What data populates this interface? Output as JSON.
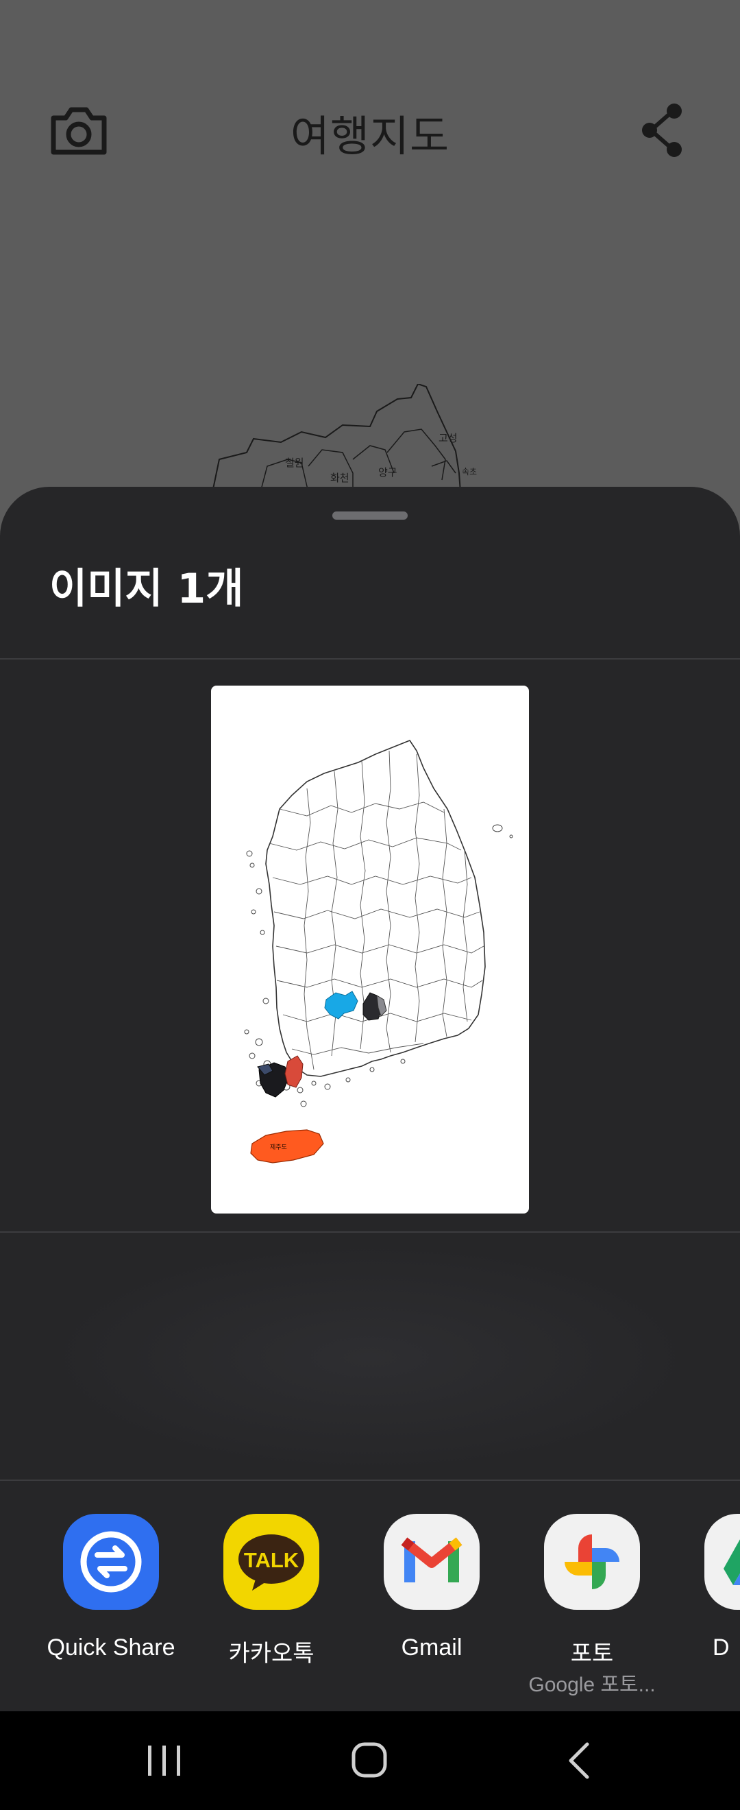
{
  "app": {
    "title": "여행지도",
    "camera_icon": "camera-icon",
    "share_icon": "share-icon",
    "map_labels": [
      "철원",
      "화천",
      "양구",
      "고성",
      "속초"
    ]
  },
  "sheet": {
    "title": "이미지 1개",
    "preview_region_labels": [
      "제주도"
    ],
    "colors": {
      "background": "#262628",
      "highlight_blue": "#18a8e6",
      "highlight_red": "#d84a3a",
      "highlight_orange": "#ff5a1f",
      "highlight_dark": "#2a2a2e"
    }
  },
  "share_targets": [
    {
      "label": "Quick Share",
      "sub": "",
      "icon": "quick-share-icon"
    },
    {
      "label": "카카오톡",
      "sub": "",
      "icon": "kakaotalk-icon",
      "badge": "TALK"
    },
    {
      "label": "Gmail",
      "sub": "",
      "icon": "gmail-icon"
    },
    {
      "label": "포토",
      "sub": "Google 포토...",
      "icon": "google-photos-icon"
    },
    {
      "label": "D",
      "sub": "",
      "icon": "google-drive-icon"
    }
  ],
  "navbar": {
    "recents": "recents-icon",
    "home": "home-icon",
    "back": "back-icon"
  }
}
